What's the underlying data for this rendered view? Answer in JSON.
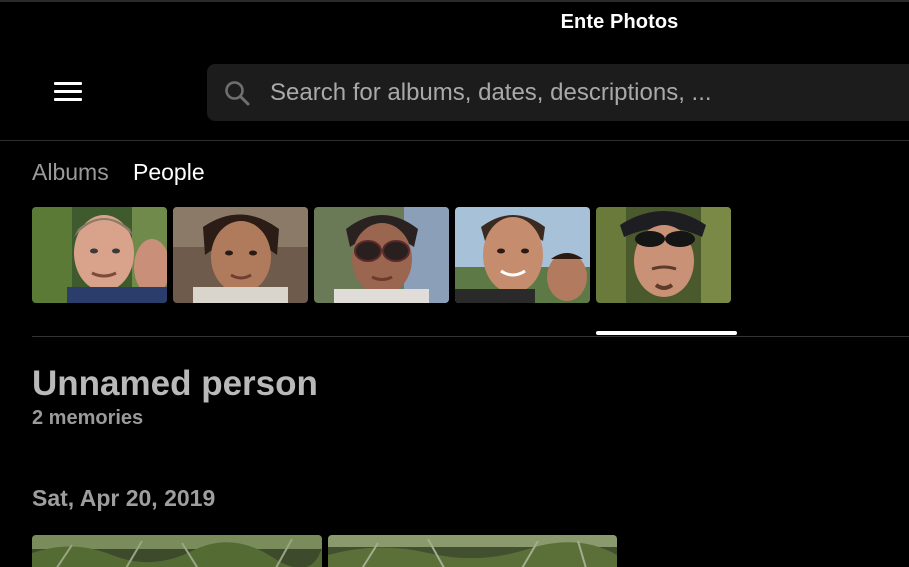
{
  "window": {
    "title": "Ente Photos"
  },
  "header": {
    "menu_icon": "hamburger-menu-icon",
    "search": {
      "icon": "search-icon",
      "placeholder": "Search for albums, dates, descriptions, ..."
    }
  },
  "tabs": [
    {
      "label": "Albums",
      "active": false
    },
    {
      "label": "People",
      "active": true
    }
  ],
  "people": [
    {
      "id": "person-1",
      "selected": false
    },
    {
      "id": "person-2",
      "selected": false
    },
    {
      "id": "person-3",
      "selected": false
    },
    {
      "id": "person-4",
      "selected": false
    },
    {
      "id": "person-5",
      "selected": true
    }
  ],
  "person_detail": {
    "name": "Unnamed person",
    "count_label": "2 memories"
  },
  "groups": [
    {
      "date": "Sat, Apr 20, 2019",
      "photo_count": 2
    }
  ],
  "colors": {
    "background": "#000000",
    "search_bg": "#1c1c1c",
    "active_tab": "#ffffff",
    "inactive_tab": "#9a9a9a"
  }
}
